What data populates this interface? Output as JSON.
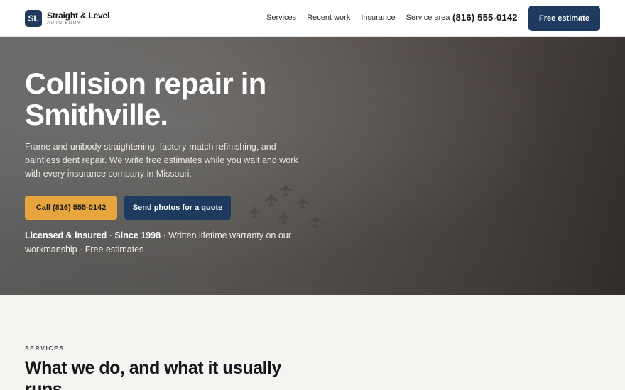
{
  "header": {
    "logo_mark": "SL",
    "logo_name": "Straight & Level",
    "logo_sub": "AUTO BODY",
    "nav": [
      "Services",
      "Recent work",
      "Insurance",
      "Service area"
    ],
    "phone": "(816) 555-0142",
    "cta": "Free estimate"
  },
  "hero": {
    "title": "Collision repair in Smithville.",
    "subtitle": "Frame and unibody straightening, factory-match refinishing, and paintless dent repair. We write free estimates while you wait and work with every insurance company in Missouri.",
    "call_button": "Call (816) 555-0142",
    "photos_button": "Send photos for a quote",
    "trust_strong_1": "Licensed & insured",
    "trust_sep_1": " · ",
    "trust_strong_2": "Since 1998",
    "trust_rest": " · Written lifetime warranty on our workmanship · Free estimates"
  },
  "services": {
    "eyebrow": "SERVICES",
    "title": "What we do, and what it usually runs."
  },
  "colors": {
    "brand": "#1e3a5f",
    "accent": "#e7a63d"
  },
  "icons": {
    "hero_image": "jet-formation-image"
  }
}
